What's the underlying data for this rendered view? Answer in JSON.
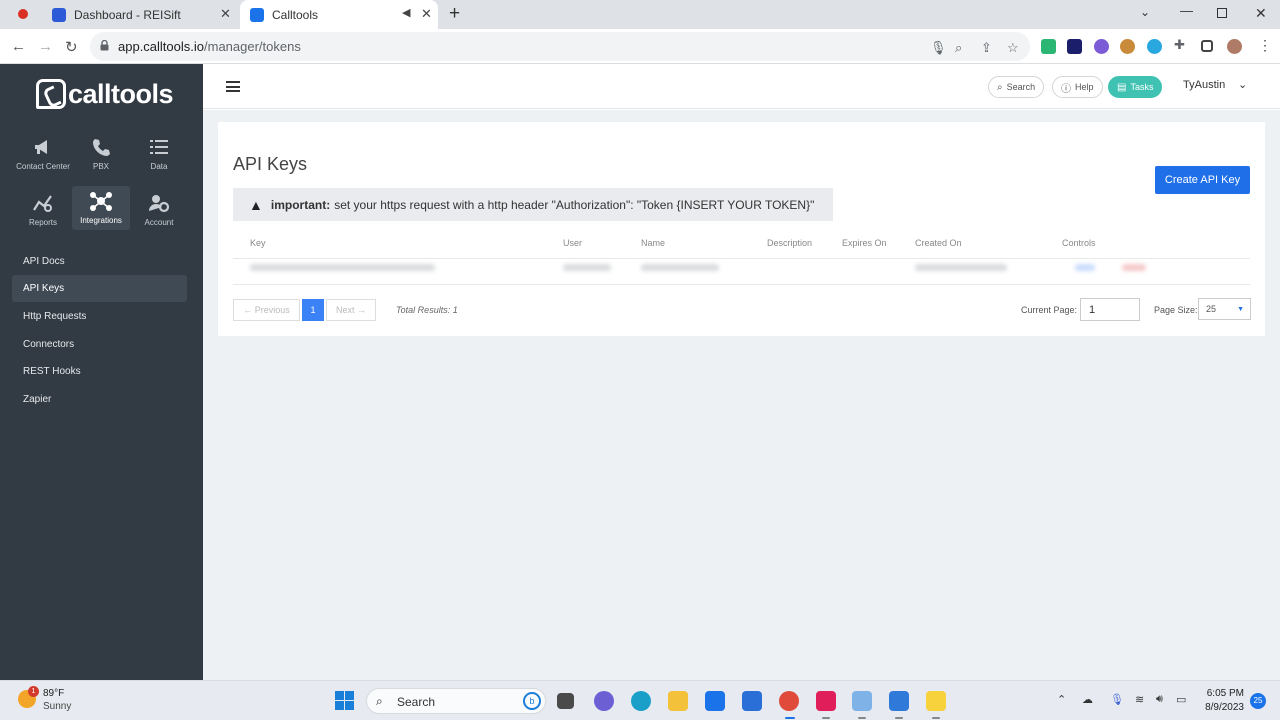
{
  "browser": {
    "tabs": [
      {
        "title": "Dashboard - REISift",
        "active": false
      },
      {
        "title": "Calltools",
        "active": true
      }
    ],
    "url_host": "app.calltools.io",
    "url_path": "/manager/tokens"
  },
  "sidebar": {
    "logo_text": "calltools",
    "modules": [
      {
        "label": "Contact Center",
        "icon": "megaphone-icon"
      },
      {
        "label": "PBX",
        "icon": "phone-icon"
      },
      {
        "label": "Data",
        "icon": "list-icon"
      },
      {
        "label": "Reports",
        "icon": "chart-icon"
      },
      {
        "label": "Integrations",
        "icon": "integrations-icon",
        "active": true
      },
      {
        "label": "Account",
        "icon": "account-gear-icon"
      }
    ],
    "links": [
      {
        "label": "API Docs"
      },
      {
        "label": "API Keys",
        "active": true
      },
      {
        "label": "Http Requests"
      },
      {
        "label": "Connectors"
      },
      {
        "label": "REST Hooks"
      },
      {
        "label": "Zapier"
      }
    ]
  },
  "header": {
    "search_label": "Search",
    "help_label": "Help",
    "tasks_label": "Tasks",
    "user_name": "TyAustin"
  },
  "main": {
    "title": "API Keys",
    "create_label": "Create API Key",
    "alert_strong": "important:",
    "alert_text": "set your https request with a http header \"Authorization\": \"Token {INSERT YOUR TOKEN}\"",
    "columns": [
      "Key",
      "User",
      "Name",
      "Description",
      "Expires On",
      "Created On",
      "Controls"
    ],
    "pager": {
      "previous": "← Previous",
      "current": "1",
      "next": "Next →",
      "total": "Total Results: 1",
      "current_page_label": "Current Page:",
      "current_page_value": "1",
      "page_size_label": "Page Size:",
      "page_size_value": "25"
    }
  },
  "taskbar": {
    "weather_temp": "89°F",
    "weather_desc": "Sunny",
    "weather_badge": "1",
    "search_label": "Search",
    "time": "6:05 PM",
    "date": "8/9/2023",
    "notification_count": "25"
  },
  "colors": {
    "sidebar_bg": "#323b44",
    "primary": "#1e6fe8",
    "tasks": "#3fc2b2",
    "content_bg": "#eef1f4"
  }
}
